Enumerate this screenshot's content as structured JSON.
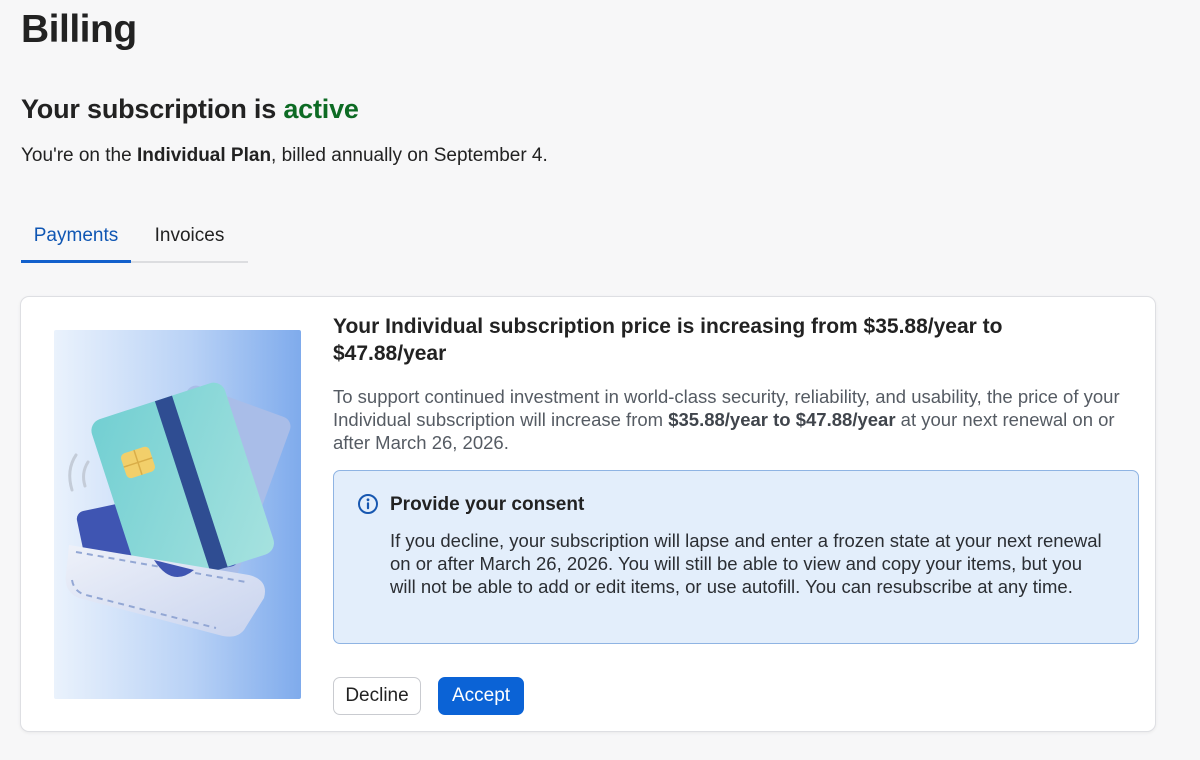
{
  "page": {
    "title": "Billing"
  },
  "subscription": {
    "heading_prefix": "Your subscription is ",
    "status": "active",
    "plan_prefix": "You're on the ",
    "plan_name": "Individual Plan",
    "plan_suffix": ", billed annually on September 4."
  },
  "tabs": [
    {
      "label": "Payments",
      "active": true
    },
    {
      "label": "Invoices",
      "active": false
    }
  ],
  "notice": {
    "title": "Your Individual subscription price is increasing from $35.88/year to $47.88/year",
    "body_prefix": "To support continued investment in world-class security, reliability, and usability, the price of your Individual subscription will increase from ",
    "body_bold": "$35.88/year to $47.88/year",
    "body_suffix": " at your next renewal on or after March 26, 2026."
  },
  "consent": {
    "icon": "info-icon",
    "title": "Provide your consent",
    "text": "If you decline, your subscription will lapse and enter a frozen state at your next renewal on or after March 26, 2026. You will still be able to view and copy your items, but you will not be able to add or edit items, or use autofill. You can resubscribe at any time."
  },
  "actions": {
    "decline_label": "Decline",
    "accept_label": "Accept"
  },
  "colors": {
    "active_status": "#0d6b24",
    "accent": "#0b63d6",
    "consent_bg": "#e3eefb"
  }
}
